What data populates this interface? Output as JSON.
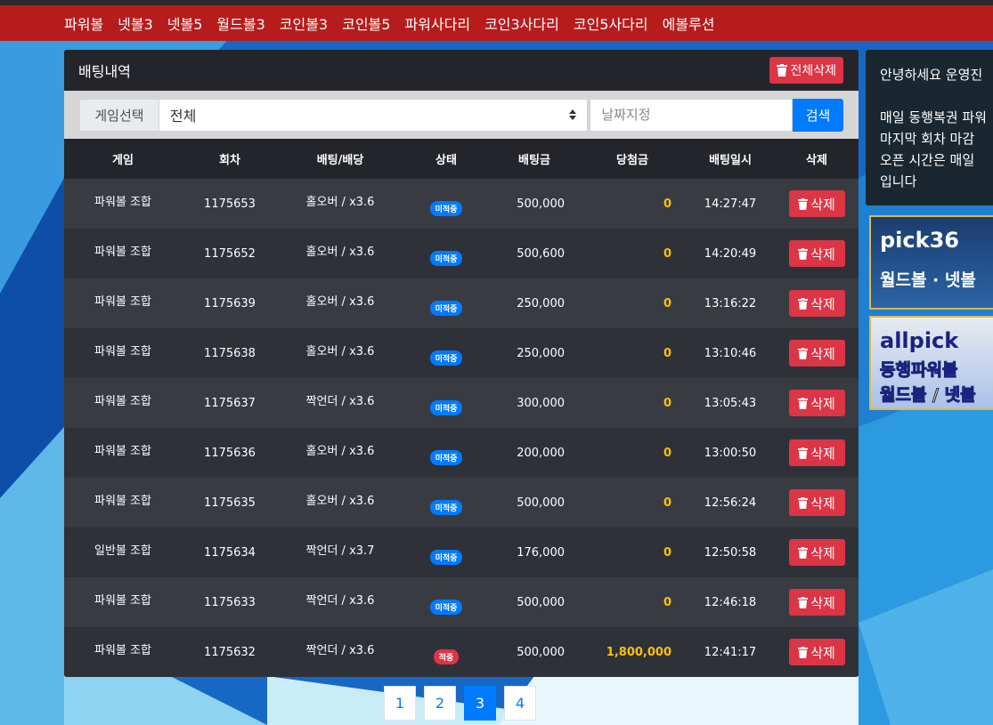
{
  "nav": {
    "items": [
      "파워볼",
      "넷볼3",
      "넷볼5",
      "월드볼3",
      "코인볼3",
      "코인볼5",
      "파워사다리",
      "코인3사다리",
      "코인5사다리",
      "에볼루션"
    ]
  },
  "panel": {
    "title": "배팅내역",
    "delete_all_label": "전체삭제"
  },
  "filter": {
    "label": "게임선택",
    "selected": "전체",
    "date_placeholder": "날짜지정",
    "search_label": "검색"
  },
  "table": {
    "headers": [
      "게임",
      "회차",
      "배팅/배당",
      "상태",
      "배팅금",
      "당첨금",
      "배팅일시",
      "삭제"
    ],
    "delete_label": "삭제",
    "rows": [
      {
        "game": "파워볼 조합",
        "round": "1175653",
        "bet": "홀오버 / x3.6",
        "status": "미적중",
        "status_type": "pending",
        "amount": "500,000",
        "win": "0",
        "time": "14:27:47"
      },
      {
        "game": "파워볼 조합",
        "round": "1175652",
        "bet": "홀오버 / x3.6",
        "status": "미적중",
        "status_type": "pending",
        "amount": "500,600",
        "win": "0",
        "time": "14:20:49"
      },
      {
        "game": "파워볼 조합",
        "round": "1175639",
        "bet": "홀오버 / x3.6",
        "status": "미적중",
        "status_type": "pending",
        "amount": "250,000",
        "win": "0",
        "time": "13:16:22"
      },
      {
        "game": "파워볼 조합",
        "round": "1175638",
        "bet": "홀오버 / x3.6",
        "status": "미적중",
        "status_type": "pending",
        "amount": "250,000",
        "win": "0",
        "time": "13:10:46"
      },
      {
        "game": "파워볼 조합",
        "round": "1175637",
        "bet": "짝언더 / x3.6",
        "status": "미적중",
        "status_type": "pending",
        "amount": "300,000",
        "win": "0",
        "time": "13:05:43"
      },
      {
        "game": "파워볼 조합",
        "round": "1175636",
        "bet": "홀오버 / x3.6",
        "status": "미적중",
        "status_type": "pending",
        "amount": "200,000",
        "win": "0",
        "time": "13:00:50"
      },
      {
        "game": "파워볼 조합",
        "round": "1175635",
        "bet": "홀오버 / x3.6",
        "status": "미적중",
        "status_type": "pending",
        "amount": "500,000",
        "win": "0",
        "time": "12:56:24"
      },
      {
        "game": "일반볼 조합",
        "round": "1175634",
        "bet": "짝언더 / x3.7",
        "status": "미적중",
        "status_type": "pending",
        "amount": "176,000",
        "win": "0",
        "time": "12:50:58"
      },
      {
        "game": "파워볼 조합",
        "round": "1175633",
        "bet": "짝언더 / x3.6",
        "status": "미적중",
        "status_type": "pending",
        "amount": "500,000",
        "win": "0",
        "time": "12:46:18"
      },
      {
        "game": "파워볼 조합",
        "round": "1175632",
        "bet": "짝언더 / x3.6",
        "status": "적중",
        "status_type": "hit",
        "amount": "500,000",
        "win": "1,800,000",
        "time": "12:41:17"
      }
    ]
  },
  "pagination": {
    "pages": [
      "1",
      "2",
      "3",
      "4"
    ],
    "active": 2
  },
  "sidebar": {
    "notice_lines": [
      "안녕하세요 운영진",
      "",
      "매일 동행복권 파워",
      "마지막 회차 마감",
      "오픈 시간은 매일",
      "입니다"
    ],
    "banner1": {
      "logo": "pick36",
      "sub": "월드볼 · 넷볼"
    },
    "banner2": {
      "logo": "allpick",
      "sub1": "동행파워볼",
      "sub2": "월드볼 / 넷볼"
    }
  },
  "colors": {
    "nav_bg": "#b71c1c",
    "panel_bg": "#2f3138",
    "accent_blue": "#007bff",
    "danger_red": "#dc3545",
    "win_yellow": "#ffc107"
  }
}
